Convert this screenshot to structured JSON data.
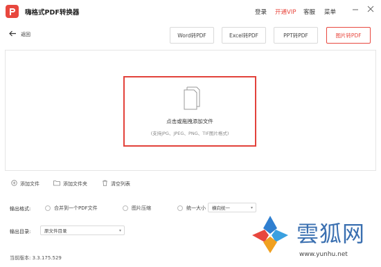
{
  "app": {
    "title": "嗨格式PDF转换器",
    "menu": {
      "login": "登录",
      "vip": "开通VIP",
      "service": "客服",
      "menu": "菜单"
    }
  },
  "nav": {
    "back_label": "返回"
  },
  "modes": [
    {
      "label": "Word转PDF",
      "active": false
    },
    {
      "label": "Excel转PDF",
      "active": false
    },
    {
      "label": "PPT转PDF",
      "active": false
    },
    {
      "label": "图片转PDF",
      "active": true
    }
  ],
  "dropzone": {
    "title": "点击或拖拽添加文件",
    "hint": "(支持JPG、JPEG、PNG、TIF图片格式)"
  },
  "actions": {
    "add_file": "添加文件",
    "add_folder": "添加文件夹",
    "clear_list": "清空列表"
  },
  "output_format": {
    "label": "输出格式:",
    "options": [
      "合并到一个PDF文件",
      "图片压缩",
      "统一大小"
    ],
    "size_select": "横向统一"
  },
  "output_dir": {
    "label": "输出目录:",
    "value": "原文件目录"
  },
  "version_text": "当前版本: 3.3.175.529",
  "watermark": {
    "cn_text": "雲狐网",
    "url": "www.yunhu.net"
  },
  "colors": {
    "accent": "#e8473e",
    "border": "#d9d9d9",
    "watermark_blue": "#3a6fb0"
  }
}
